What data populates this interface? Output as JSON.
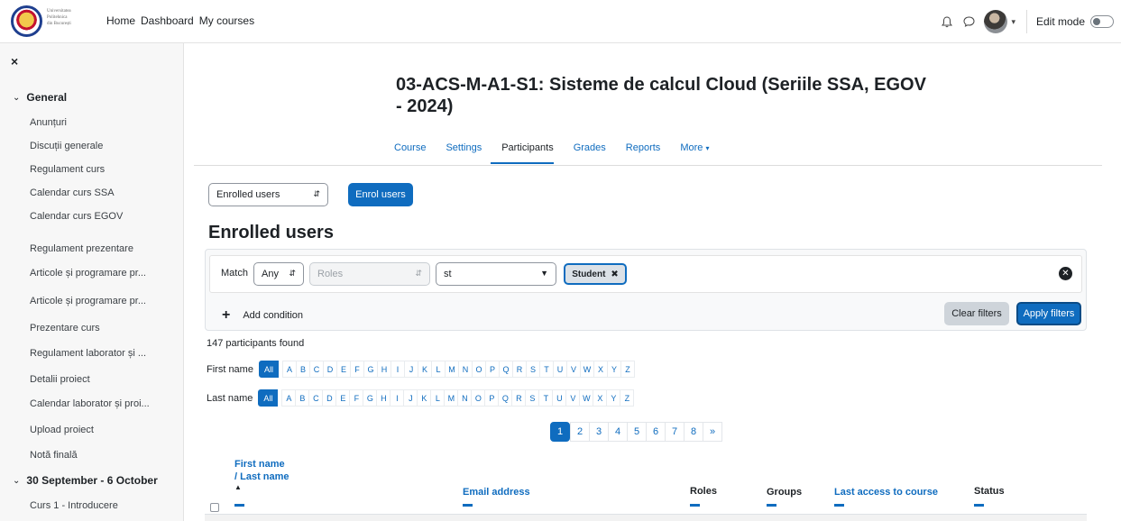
{
  "header": {
    "logo_text": [
      "Universitatea",
      "Politehnica",
      "din București"
    ],
    "nav": [
      "Home",
      "Dashboard",
      "My courses"
    ],
    "edit_mode_label": "Edit mode"
  },
  "sidebar": {
    "close": "×",
    "sections": [
      {
        "title": "General",
        "items": [
          "Anunțuri",
          "Discuții generale",
          "Regulament curs",
          "Calendar curs SSA",
          "Calendar curs EGOV",
          "Regulament prezentare",
          "Articole și programare pr...",
          "Articole și programare pr...",
          "Prezentare curs",
          "Regulament laborator și ...",
          "Detalii proiect",
          "Calendar laborator și proi...",
          "Upload proiect",
          "Notă finală"
        ]
      },
      {
        "title": "30 September - 6 October",
        "items": [
          "Curs 1 - Introducere"
        ]
      }
    ]
  },
  "course": {
    "title": "03-ACS-M-A1-S1: Sisteme de calcul Cloud (Seriile SSA, EGOV - 2024)",
    "tabs": [
      "Course",
      "Settings",
      "Participants",
      "Grades",
      "Reports",
      "More"
    ],
    "active_tab": "Participants"
  },
  "participants": {
    "view_select": "Enrolled users",
    "enrol_button": "Enrol users",
    "heading": "Enrolled users",
    "filter": {
      "match_label": "Match",
      "match_value": "Any",
      "type_placeholder": "Roles",
      "search_value": "st",
      "tag": "Student",
      "add_condition": "Add condition",
      "clear": "Clear filters",
      "apply": "Apply filters"
    },
    "found": "147 participants found",
    "first_name_label": "First name",
    "last_name_label": "Last name",
    "letters": [
      "All",
      "A",
      "B",
      "C",
      "D",
      "E",
      "F",
      "G",
      "H",
      "I",
      "J",
      "K",
      "L",
      "M",
      "N",
      "O",
      "P",
      "Q",
      "R",
      "S",
      "T",
      "U",
      "V",
      "W",
      "X",
      "Y",
      "Z"
    ],
    "pages": [
      "1",
      "2",
      "3",
      "4",
      "5",
      "6",
      "7",
      "8",
      "»"
    ],
    "active_page": "1",
    "columns": {
      "first_name": "First name",
      "last_name": "/ Last name",
      "email": "Email address",
      "roles": "Roles",
      "groups": "Groups",
      "last_access": "Last access to course",
      "status": "Status"
    },
    "sort_indicator": "▲"
  },
  "colors": {
    "primary": "#0f6cbf",
    "sidebar_bg": "#f7f7f7",
    "secondary_button": "#ced4da"
  }
}
